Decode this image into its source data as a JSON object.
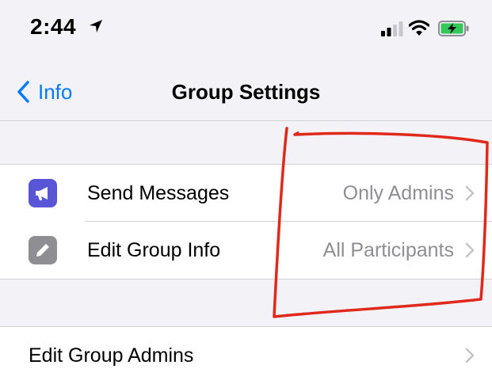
{
  "status_bar": {
    "time": "2:44",
    "icons": [
      "location-arrow-icon",
      "signal-icon",
      "wifi-icon",
      "battery-charging-icon"
    ]
  },
  "nav": {
    "back_label": "Info",
    "title": "Group Settings"
  },
  "settings": {
    "send_messages": {
      "label": "Send Messages",
      "value": "Only Admins",
      "icon": "megaphone-icon",
      "icon_color": "#5856d6"
    },
    "edit_group_info": {
      "label": "Edit Group Info",
      "value": "All Participants",
      "icon": "pencil-icon",
      "icon_color": "#8e8e93"
    }
  },
  "admins": {
    "label": "Edit Group Admins"
  },
  "colors": {
    "accent": "#007aff",
    "background": "#f2f2f7",
    "annotation": "#e0281b",
    "battery_charge": "#34c759"
  }
}
